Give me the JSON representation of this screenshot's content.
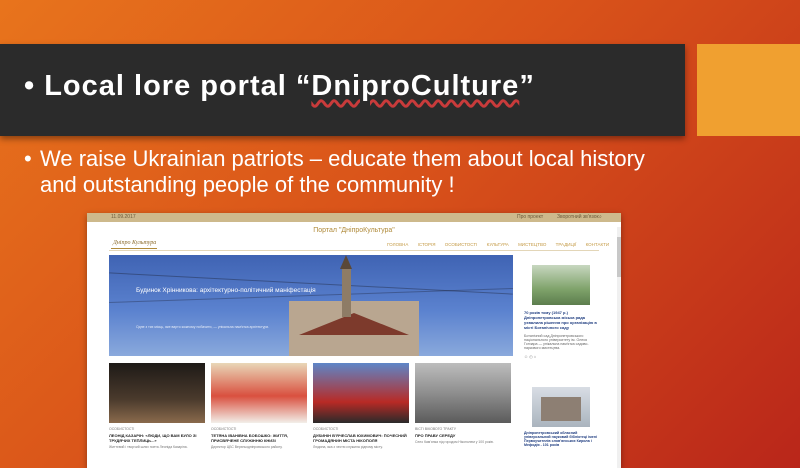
{
  "slide": {
    "title_prefix": "• Local  lore  portal  “",
    "title_brand": "DniproCulture",
    "title_suffix": "”",
    "bullet": "•",
    "subtitle": "We raise Ukrainian patriots – educate them about local history and outstanding people of the community !"
  },
  "site": {
    "topstrip": {
      "left": "11.09.2017",
      "right_1": "Про проект",
      "right_2": "Зворотний зв'язок"
    },
    "portal_title": "Портал \"ДніпроКультура\"",
    "logo": "Дніпро Культура",
    "nav": [
      "ГОЛОВНА",
      "ІСТОРІЯ",
      "ОСОБИСТОСТІ",
      "КУЛЬТУРА",
      "МИСТЕЦТВО",
      "ТРАДИЦІЇ",
      "КОНТАКТИ"
    ],
    "hero": {
      "title": "Будинок Хрінникова: архітектурно-політичний маніфестація",
      "text": "Одне з тих місць, яке варто кожному побачити, — унікальна пам'ятка архітектури."
    },
    "side": {
      "title": "70 років тому (1947 р.) Дніпропетровська міська рада ухвалила рішення про організацію в місті Ботанічного саду",
      "desc": "Ботанічний сад Дніпропетровського національного університету ім. Олеся Гончара — унікальна пам'ятка садово-паркового мистецтва.",
      "icons": "☺   ◴   ⌂",
      "title2": "Дніпропетровський обласний універсальний науковий бібліотеці імені Первоучителів слов'янських Кирила і Мефодія - 101 років"
    },
    "news": [
      {
        "cat": "ОСОБИСТОСТІ",
        "h": "ЛЕОНІД КАЗАРІН: «ЛЮДИ, ЩО ВАМ БУЛО ЗІ ТРУДЯЧИХ ТЕПЛИЦЬ...»",
        "p": "Життєвий і творчий шлях поета Леоніда Казаріна."
      },
      {
        "cat": "ОСОБИСТОСТІ",
        "h": "ТЕТЯНА ІВАНІВНА БОБОШКО: ЖИТТЯ, ПРИСВЯЧЕНЕ СЛУЖІННЮ КНИЗІ",
        "p": "Директор ЦБС Верхньодніпровського району."
      },
      {
        "cat": "ОСОБИСТОСТІ",
        "h": "ДУБИНІН В'ЯЧЕСЛАВ ЮХИМОВИЧ: ПОЧЕСНИЙ ГРОМАДЯНИН МІСТА НІКОПОЛЯ",
        "p": "Людина, яка з честю служила рідному місту."
      },
      {
        "cat": "ВІСТІ ВІКОВОГО ТРАКТУ",
        "h": "ПРО ПРАВУ СЕРЕДУ",
        "p": "Село Кам'янка під городом Нікополем у 100 років."
      }
    ]
  }
}
